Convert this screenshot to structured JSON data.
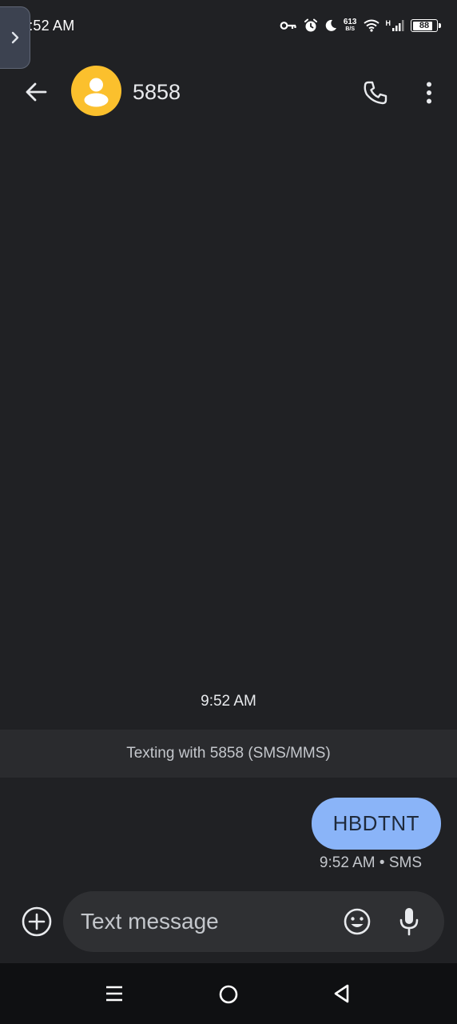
{
  "status_bar": {
    "time": "9:52 AM",
    "net_speed_value": "613",
    "net_speed_unit": "B/S",
    "network_type": "H",
    "battery_level": "88",
    "icons": [
      "vpn-key-icon",
      "alarm-icon",
      "do-not-disturb-moon-icon",
      "wifi-icon",
      "signal-icon",
      "battery-icon"
    ]
  },
  "app_bar": {
    "contact_name": "5858",
    "icons": [
      "back-arrow-icon",
      "contact-avatar-icon",
      "phone-call-icon",
      "more-vert-icon"
    ],
    "avatar_color": "#fbc02d"
  },
  "conversation": {
    "timestamp": "9:52 AM",
    "banner": "Texting with 5858 (SMS/MMS)",
    "messages": [
      {
        "text": "HBDTNT",
        "meta": "9:52 AM • SMS",
        "direction": "outgoing",
        "color": "#8ab4f8"
      }
    ]
  },
  "composer": {
    "placeholder": "Text message",
    "icons": [
      "add-circle-icon",
      "emoji-icon",
      "microphone-icon"
    ]
  },
  "nav_bar": {
    "icons": [
      "recents-menu-icon",
      "home-circle-icon",
      "back-triangle-icon"
    ]
  },
  "colors": {
    "background": "#202124",
    "banner": "#2a2b2e",
    "composer": "#2f3033",
    "nav": "#0f1012"
  }
}
